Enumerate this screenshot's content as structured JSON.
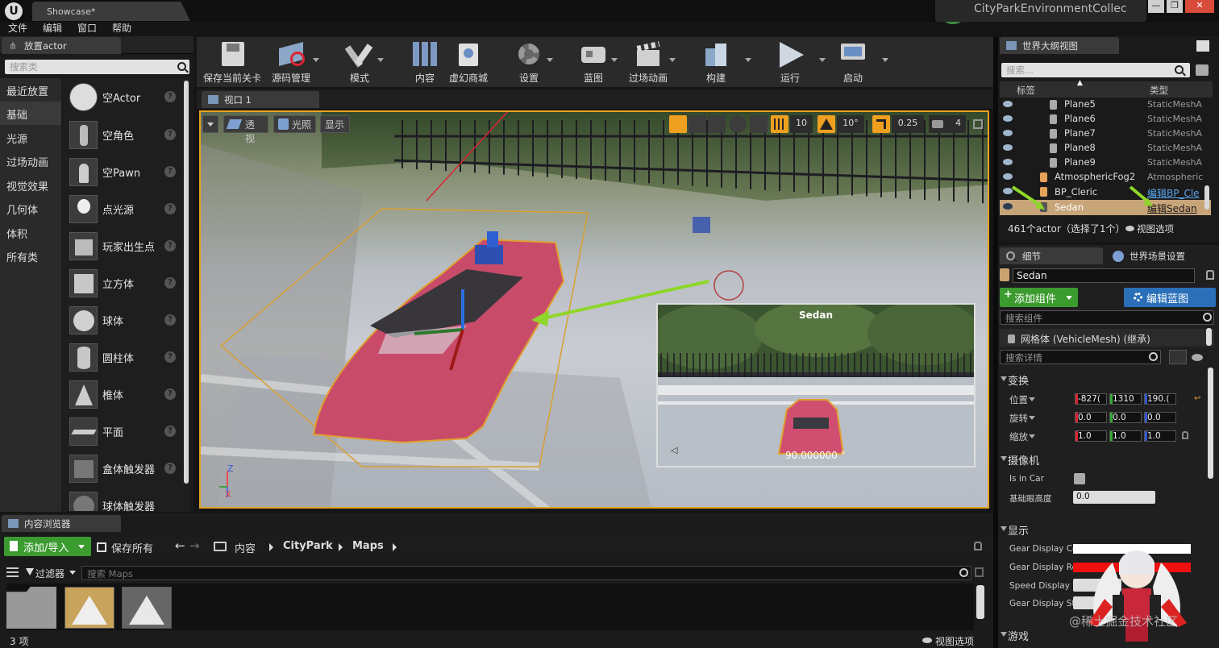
{
  "window": {
    "tab_title": "Showcase*",
    "project_name": "CityParkEnvironmentCollec",
    "min_label": "—",
    "max_label": "❐",
    "close_label": "✕"
  },
  "menu": [
    "文件",
    "编辑",
    "窗口",
    "帮助"
  ],
  "place_actors": {
    "tab_label": "放置actor",
    "search_placeholder": "搜索类",
    "categories": [
      "最近放置",
      "基础",
      "光源",
      "过场动画",
      "视觉效果",
      "几何体",
      "体积",
      "所有类"
    ],
    "selected_category": "基础",
    "items": [
      "空Actor",
      "空角色",
      "空Pawn",
      "点光源",
      "玩家出生点",
      "立方体",
      "球体",
      "圆柱体",
      "椎体",
      "平面",
      "盒体触发器",
      "球体触发器"
    ],
    "help_glyph": "?"
  },
  "toolbar": {
    "buttons": [
      "保存当前关卡",
      "源码管理",
      "模式",
      "内容",
      "虚幻商城",
      "设置",
      "蓝图",
      "过场动画",
      "构建",
      "运行",
      "启动"
    ]
  },
  "viewport": {
    "tab_label": "视口 1",
    "perspective": "透视",
    "lighting": "光照",
    "show": "显示",
    "grid_snap": "10",
    "rot_snap": "10°",
    "scale_snap": "0.25",
    "camera_speed": "4",
    "pip_title": "Sedan",
    "pip_value": "90.000000 °",
    "axis_z": "Z",
    "axis_x": "X"
  },
  "outliner": {
    "tab_label": "世界大纲视图",
    "search_placeholder": "搜索...",
    "col_label": "标签",
    "col_type": "类型",
    "rows": [
      {
        "label": "Plane5",
        "type": "StaticMeshA"
      },
      {
        "label": "Plane6",
        "type": "StaticMeshA"
      },
      {
        "label": "Plane7",
        "type": "StaticMeshA"
      },
      {
        "label": "Plane8",
        "type": "StaticMeshA"
      },
      {
        "label": "Plane9",
        "type": "StaticMeshA"
      },
      {
        "label": "AtmosphericFog2",
        "type": "Atmospheric"
      },
      {
        "label": "BP_Cleric",
        "type": "编辑BP_Cle"
      },
      {
        "label": "Sedan",
        "type": "编辑Sedan"
      }
    ],
    "footer": "461个actor（选择了1个）",
    "view_options": "视图选项"
  },
  "details": {
    "tab_label": "细节",
    "world_tab_label": "世界场景设置",
    "name_value": "Sedan",
    "add_component": "添加组件",
    "edit_blueprint": "编辑蓝图",
    "search_components": "搜索组件",
    "mesh_row": "网格体 (VehicleMesh) (继承)",
    "search_details": "搜索详情",
    "transform_hdr": "变换",
    "location_lbl": "位置",
    "rotation_lbl": "旋转",
    "scale_lbl": "缩放",
    "location": [
      "-827(",
      "1310",
      "190.("
    ],
    "rotation": [
      "0.0",
      "0.0",
      "0.0"
    ],
    "scale": [
      "1.0",
      "1.0",
      "1.0"
    ],
    "camera_hdr": "摄像机",
    "is_in_car": "Is in Car",
    "base_eye": "基础眼高度",
    "base_eye_val": "0.0",
    "display_hdr": "显示",
    "gear_color": "Gear Display Co",
    "gear_reverse": "Gear Display Re",
    "speed_display": "Speed Display S",
    "gear_str": "Gear Display Str",
    "game_hdr": "游戏",
    "watermark": "@稀土掘金技术社区"
  },
  "content_browser": {
    "tab_label": "内容浏览器",
    "add_import": "添加/导入",
    "save_all": "保存所有",
    "crumbs": [
      "内容",
      "CityPark",
      "Maps"
    ],
    "filter": "过滤器",
    "search_placeholder": "搜索 Maps",
    "item_count": "3 项",
    "view_options": "视图选项"
  }
}
